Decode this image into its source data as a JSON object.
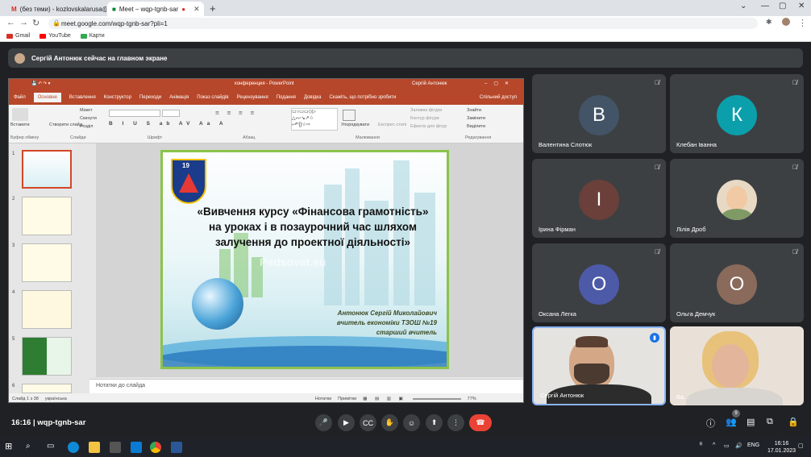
{
  "browser": {
    "tabs": [
      {
        "label": "(без теми) - kozlovskalarusa@g..."
      },
      {
        "label": "Meet – wqp-tgnb-sar"
      }
    ],
    "url": "meet.google.com/wqp-tgnb-sar?pli=1",
    "bookmarks": [
      "Gmail",
      "YouTube",
      "Карти"
    ]
  },
  "meet": {
    "presenter_banner": "Сергій Антонюк сейчас на главном экране",
    "meeting_time": "16:16",
    "meeting_code": "wqp-tgnb-sar",
    "participant_count": "9",
    "participants": [
      {
        "name": "Валентина Слотюк",
        "initial": "В",
        "color": "#425466"
      },
      {
        "name": "Клебан Іванна",
        "initial": "К",
        "color": "#0b9fab"
      },
      {
        "name": "Ірина Фірман",
        "initial": "І",
        "color": "#6b3f3a"
      },
      {
        "name": "Лілія Дроб",
        "initial": "",
        "color": "#c9b8a0"
      },
      {
        "name": "Оксана Легка",
        "initial": "О",
        "color": "#4d5aa8"
      },
      {
        "name": "Ольга Демчук",
        "initial": "О",
        "color": "#8a6a5b"
      },
      {
        "name": "Сергій Антонюк",
        "initial": "",
        "color": "#e5e3e0"
      },
      {
        "name": "Ва...",
        "initial": "",
        "color": "#e9e1d8"
      }
    ]
  },
  "powerpoint": {
    "window_title": "конференция - PowerPoint",
    "user": "Сергій Антонюк",
    "menu": [
      "Файл",
      "Основне",
      "Вставлення",
      "Конструктор",
      "Переходи",
      "Анімація",
      "Показ слайдів",
      "Рецензування",
      "Подання",
      "Довідка",
      "Скажіть, що потрібно зробити",
      "Спільний доступ"
    ],
    "ribbon_groups": [
      "Буфер обміну",
      "Слайди",
      "Шрифт",
      "Абзац",
      "Малювання",
      "Редагування"
    ],
    "ribbon_buttons": [
      "Вставити",
      "Створити слайд",
      "Макет",
      "Скинути",
      "Розділ",
      "Упорядкувати",
      "Експрес-стилі",
      "Заливка фігури",
      "Контур фігури",
      "Ефекти для фігур",
      "Знайти",
      "Замінити",
      "Виділити"
    ],
    "slide_numbers": [
      "1",
      "2",
      "3",
      "4",
      "5",
      "6"
    ],
    "slide": {
      "title": "«Вивчення курсу «Фінансова грамотність» на уроках і в позаурочний час шляхом залучення до проектної діяльності»",
      "author": "Антонюк Сергій Миколайович",
      "position": "вчитель економіки ТЗОШ №19",
      "rank": "старший вчитель",
      "emblem_number": "19",
      "watermark": "Pedsovet.su"
    },
    "notes_placeholder": "Нотатки до слайда",
    "status": {
      "slide_counter": "Слайд 1 з 38",
      "language": "українська",
      "notes": "Нотатки",
      "comments": "Примітки",
      "zoom": "77%"
    }
  },
  "taskbar": {
    "lang": "ENG",
    "time": "16:16",
    "date": "17.01.2023"
  }
}
